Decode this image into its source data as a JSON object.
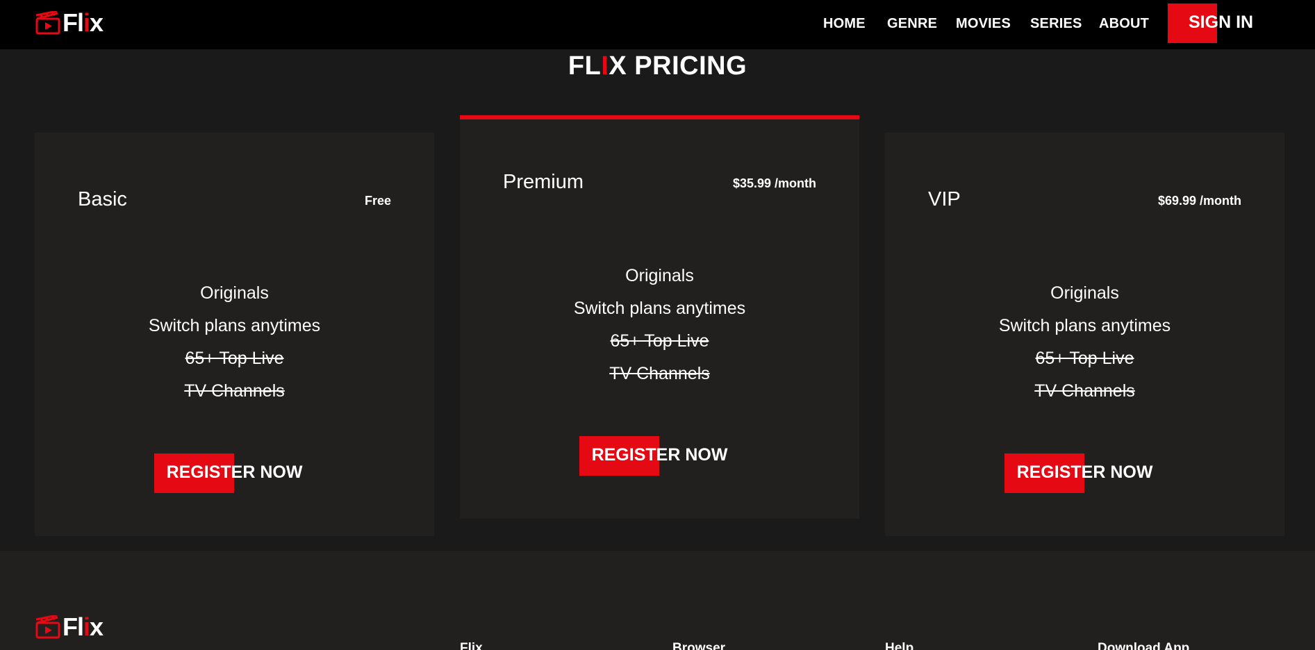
{
  "brand": {
    "name_prefix": "Fl",
    "name_accent": "i",
    "name_suffix": "x"
  },
  "nav": {
    "items": [
      "HOME",
      "GENRE",
      "MOVIES",
      "SERIES",
      "ABOUT"
    ],
    "signin_label": "SIGN IN"
  },
  "pricing": {
    "title_prefix": "FL",
    "title_accent": "I",
    "title_suffix": "X PRICING",
    "plans": [
      {
        "name": "Basic",
        "price": "Free",
        "features": [
          "Originals",
          "Switch plans anytimes"
        ],
        "unavailable": [
          "65+ Top Live",
          "TV Channels"
        ],
        "button": "REGISTER NOW"
      },
      {
        "name": "Premium",
        "price": "$35.99 /month",
        "features": [
          "Originals",
          "Switch plans anytimes"
        ],
        "unavailable": [
          "65+ Top Live",
          "TV Channels"
        ],
        "button": "REGISTER NOW"
      },
      {
        "name": "VIP",
        "price": "$69.99 /month",
        "features": [
          "Originals",
          "Switch plans anytimes"
        ],
        "unavailable": [
          "65+ Top Live",
          "TV Channels"
        ],
        "button": "REGISTER NOW"
      }
    ]
  },
  "footer": {
    "columns": [
      "Flix",
      "Browser",
      "Help",
      "Download App"
    ]
  },
  "colors": {
    "accent": "#e50914",
    "header_bg": "#000000",
    "card_bg": "#221f1f",
    "page_bg": "#1b1a1a"
  }
}
